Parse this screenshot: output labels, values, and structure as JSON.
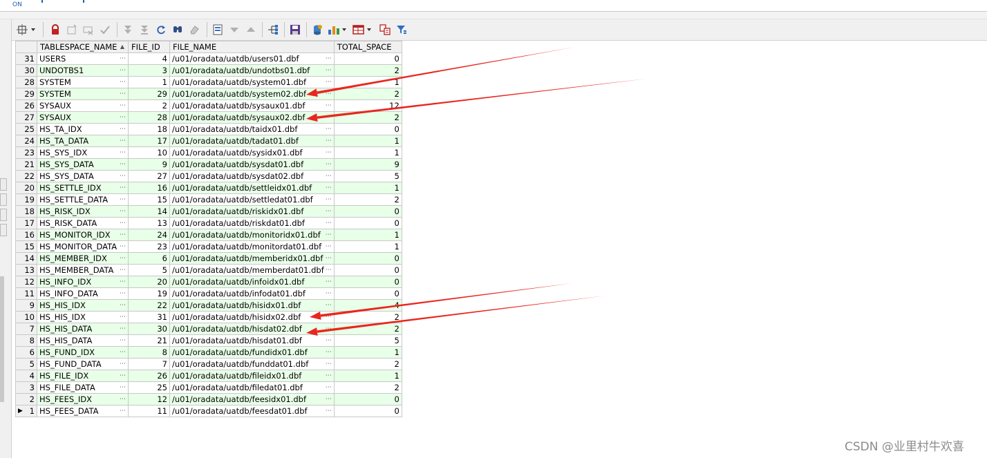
{
  "top_hint": "ON",
  "toolbar": {
    "icons": [
      "grid-options-icon",
      "lock-icon",
      "insert-record-icon",
      "delete-record-icon",
      "post-changes-icon",
      "fetch-next-page-icon",
      "fetch-last-page-icon",
      "refresh-icon",
      "find-icon",
      "clear-icon",
      "single-record-view-icon",
      "filter-down-icon",
      "filter-up-icon",
      "query-by-example-icon",
      "save-icon",
      "export-icon",
      "chart-icon",
      "table-view-icon",
      "compare-icon",
      "filter-icon"
    ]
  },
  "grid": {
    "columns": [
      "TABLESPACE_NAME",
      "FILE_ID",
      "FILE_NAME",
      "TOTAL_SPACE"
    ],
    "rows": [
      {
        "rn": "31",
        "name": "USERS",
        "file_id": "4",
        "file_name": "/u01/oradata/uatdb/users01.dbf",
        "total": "0",
        "alt": false
      },
      {
        "rn": "30",
        "name": "UNDOTBS1",
        "file_id": "3",
        "file_name": "/u01/oradata/uatdb/undotbs01.dbf",
        "total": "2",
        "alt": true
      },
      {
        "rn": "28",
        "name": "SYSTEM",
        "file_id": "1",
        "file_name": "/u01/oradata/uatdb/system01.dbf",
        "total": "1",
        "alt": false
      },
      {
        "rn": "29",
        "name": "SYSTEM",
        "file_id": "29",
        "file_name": "/u01/oradata/uatdb/system02.dbf",
        "total": "2",
        "alt": true
      },
      {
        "rn": "26",
        "name": "SYSAUX",
        "file_id": "2",
        "file_name": "/u01/oradata/uatdb/sysaux01.dbf",
        "total": "12",
        "alt": false
      },
      {
        "rn": "27",
        "name": "SYSAUX",
        "file_id": "28",
        "file_name": "/u01/oradata/uatdb/sysaux02.dbf",
        "total": "2",
        "alt": true
      },
      {
        "rn": "25",
        "name": "HS_TA_IDX",
        "file_id": "18",
        "file_name": "/u01/oradata/uatdb/taidx01.dbf",
        "total": "0",
        "alt": false
      },
      {
        "rn": "24",
        "name": "HS_TA_DATA",
        "file_id": "17",
        "file_name": "/u01/oradata/uatdb/tadat01.dbf",
        "total": "1",
        "alt": true
      },
      {
        "rn": "23",
        "name": "HS_SYS_IDX",
        "file_id": "10",
        "file_name": "/u01/oradata/uatdb/sysidx01.dbf",
        "total": "1",
        "alt": false
      },
      {
        "rn": "21",
        "name": "HS_SYS_DATA",
        "file_id": "9",
        "file_name": "/u01/oradata/uatdb/sysdat01.dbf",
        "total": "9",
        "alt": true
      },
      {
        "rn": "22",
        "name": "HS_SYS_DATA",
        "file_id": "27",
        "file_name": "/u01/oradata/uatdb/sysdat02.dbf",
        "total": "5",
        "alt": false
      },
      {
        "rn": "20",
        "name": "HS_SETTLE_IDX",
        "file_id": "16",
        "file_name": "/u01/oradata/uatdb/settleidx01.dbf",
        "total": "1",
        "alt": true
      },
      {
        "rn": "19",
        "name": "HS_SETTLE_DATA",
        "file_id": "15",
        "file_name": "/u01/oradata/uatdb/settledat01.dbf",
        "total": "2",
        "alt": false
      },
      {
        "rn": "18",
        "name": "HS_RISK_IDX",
        "file_id": "14",
        "file_name": "/u01/oradata/uatdb/riskidx01.dbf",
        "total": "0",
        "alt": true
      },
      {
        "rn": "17",
        "name": "HS_RISK_DATA",
        "file_id": "13",
        "file_name": "/u01/oradata/uatdb/riskdat01.dbf",
        "total": "0",
        "alt": false
      },
      {
        "rn": "16",
        "name": "HS_MONITOR_IDX",
        "file_id": "24",
        "file_name": "/u01/oradata/uatdb/monitoridx01.dbf",
        "total": "1",
        "alt": true
      },
      {
        "rn": "15",
        "name": "HS_MONITOR_DATA",
        "file_id": "23",
        "file_name": "/u01/oradata/uatdb/monitordat01.dbf",
        "total": "1",
        "alt": false
      },
      {
        "rn": "14",
        "name": "HS_MEMBER_IDX",
        "file_id": "6",
        "file_name": "/u01/oradata/uatdb/memberidx01.dbf",
        "total": "0",
        "alt": true
      },
      {
        "rn": "13",
        "name": "HS_MEMBER_DATA",
        "file_id": "5",
        "file_name": "/u01/oradata/uatdb/memberdat01.dbf",
        "total": "0",
        "alt": false
      },
      {
        "rn": "12",
        "name": "HS_INFO_IDX",
        "file_id": "20",
        "file_name": "/u01/oradata/uatdb/infoidx01.dbf",
        "total": "0",
        "alt": true
      },
      {
        "rn": "11",
        "name": "HS_INFO_DATA",
        "file_id": "19",
        "file_name": "/u01/oradata/uatdb/infodat01.dbf",
        "total": "0",
        "alt": false
      },
      {
        "rn": "9",
        "name": "HS_HIS_IDX",
        "file_id": "22",
        "file_name": "/u01/oradata/uatdb/hisidx01.dbf",
        "total": "4",
        "alt": true
      },
      {
        "rn": "10",
        "name": "HS_HIS_IDX",
        "file_id": "31",
        "file_name": "/u01/oradata/uatdb/hisidx02.dbf",
        "total": "2",
        "alt": false
      },
      {
        "rn": "7",
        "name": "HS_HIS_DATA",
        "file_id": "30",
        "file_name": "/u01/oradata/uatdb/hisdat02.dbf",
        "total": "2",
        "alt": true
      },
      {
        "rn": "8",
        "name": "HS_HIS_DATA",
        "file_id": "21",
        "file_name": "/u01/oradata/uatdb/hisdat01.dbf",
        "total": "5",
        "alt": false
      },
      {
        "rn": "6",
        "name": "HS_FUND_IDX",
        "file_id": "8",
        "file_name": "/u01/oradata/uatdb/fundidx01.dbf",
        "total": "1",
        "alt": true
      },
      {
        "rn": "5",
        "name": "HS_FUND_DATA",
        "file_id": "7",
        "file_name": "/u01/oradata/uatdb/funddat01.dbf",
        "total": "2",
        "alt": false
      },
      {
        "rn": "4",
        "name": "HS_FILE_IDX",
        "file_id": "26",
        "file_name": "/u01/oradata/uatdb/fileidx01.dbf",
        "total": "1",
        "alt": true
      },
      {
        "rn": "3",
        "name": "HS_FILE_DATA",
        "file_id": "25",
        "file_name": "/u01/oradata/uatdb/filedat01.dbf",
        "total": "2",
        "alt": false
      },
      {
        "rn": "2",
        "name": "HS_FEES_IDX",
        "file_id": "12",
        "file_name": "/u01/oradata/uatdb/feesidx01.dbf",
        "total": "0",
        "alt": true
      },
      {
        "rn": "1",
        "name": "HS_FEES_DATA",
        "file_id": "11",
        "file_name": "/u01/oradata/uatdb/feesdat01.dbf",
        "total": "0",
        "alt": false,
        "current": true
      }
    ]
  },
  "annotation_arrow_color": "#e8271f",
  "alt_row_color": "#e8ffe8",
  "watermark": "CSDN @业里村牛欢喜"
}
